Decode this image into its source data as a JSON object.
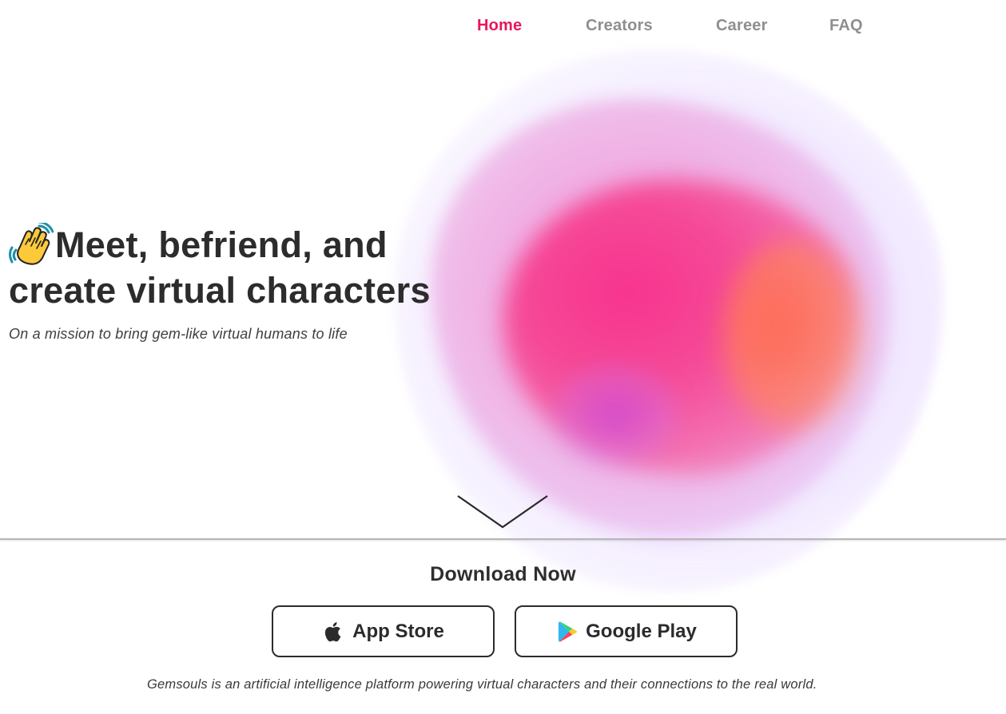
{
  "nav": {
    "items": [
      {
        "label": "Home",
        "active": true
      },
      {
        "label": "Creators",
        "active": false
      },
      {
        "label": "Career",
        "active": false
      },
      {
        "label": "FAQ",
        "active": false
      }
    ]
  },
  "hero": {
    "icon": "waving-hand-icon",
    "headline_line1": "Meet, befriend, and",
    "headline_line2": "create virtual characters",
    "subtitle": "On a mission to bring gem-like virtual humans to life",
    "scroll_icon": "chevron-down-icon"
  },
  "download": {
    "title": "Download Now",
    "app_store_label": "App Store",
    "app_store_icon": "apple-icon",
    "google_play_label": "Google Play",
    "google_play_icon": "google-play-icon"
  },
  "footer": {
    "description": "Gemsouls is an artificial intelligence platform powering virtual characters and their connections to the real world."
  },
  "colors": {
    "accent": "#e6175f",
    "nav_inactive": "#8f8f8f",
    "text_dark": "#2c2c2c",
    "blob_pink": "#f8338f",
    "blob_orange": "#ff6e50",
    "blob_lavender": "#d6beff"
  }
}
